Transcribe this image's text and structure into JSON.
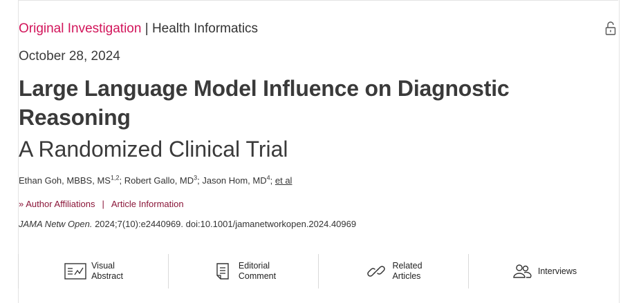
{
  "header": {
    "article_type": "Original Investigation",
    "separator": "|",
    "subject": "Health Informatics"
  },
  "date": "October 28, 2024",
  "title": "Large Language Model Influence on Diagnostic Reasoning",
  "subtitle": "A Randomized Clinical Trial",
  "authors": {
    "a1_name": "Ethan Goh, MBBS, MS",
    "a1_sup": "1,2",
    "a2_name": "Robert Gallo, MD",
    "a2_sup": "3",
    "a3_name": "Jason Hom, MD",
    "a3_sup": "4",
    "sep": ";",
    "etal": "et al"
  },
  "links": {
    "chevron": "»",
    "affiliations": "Author Affiliations",
    "bar": "|",
    "article_info": "Article Information"
  },
  "citation": {
    "journal": "JAMA Netw Open.",
    "rest": "2024;7(10):e2440969. doi:10.1001/jamanetworkopen.2024.40969"
  },
  "tools": [
    {
      "line1": "Visual",
      "line2": "Abstract",
      "icon": "visual-abstract-icon"
    },
    {
      "line1": "Editorial",
      "line2": "Comment",
      "icon": "document-icon"
    },
    {
      "line1": "Related",
      "line2": "Articles",
      "icon": "link-icon"
    },
    {
      "line1": "Interviews",
      "line2": "",
      "icon": "people-icon"
    }
  ],
  "colors": {
    "article_type": "#d2145a",
    "link": "#8a1538",
    "text": "#333333"
  }
}
